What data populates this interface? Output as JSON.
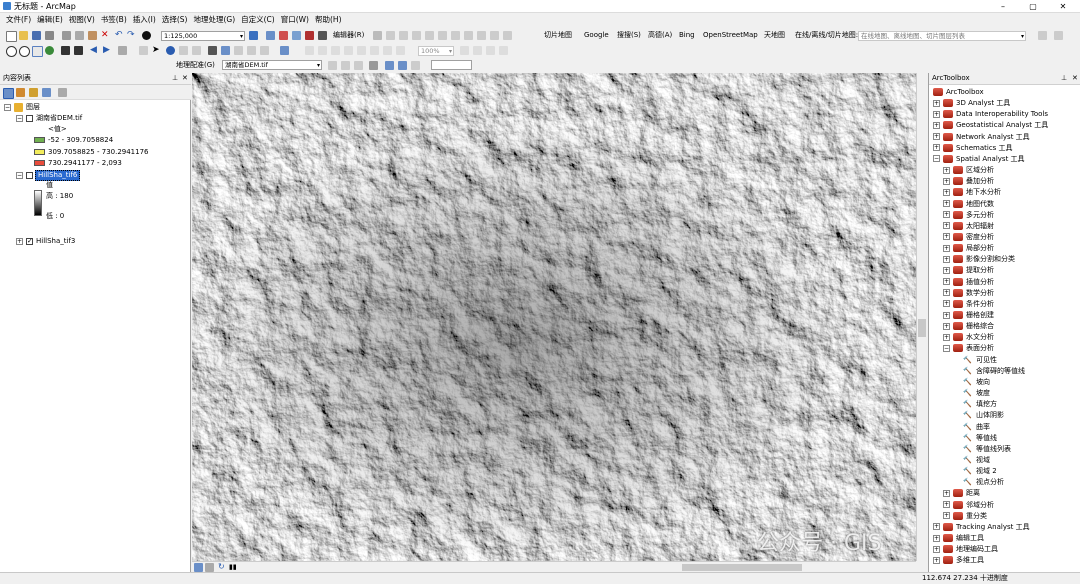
{
  "window": {
    "title": "无标题 - ArcMap"
  },
  "menu": [
    "文件(F)",
    "编辑(E)",
    "视图(V)",
    "书签(B)",
    "插入(I)",
    "选择(S)",
    "地理处理(G)",
    "自定义(C)",
    "窗口(W)",
    "帮助(H)"
  ],
  "toolbar": {
    "scale": "1:125,000",
    "editor": "编辑器(R)",
    "zoom_pct": "100%",
    "cut_map": "切片地图",
    "google": "Google",
    "baidu": "搜搜(S)",
    "gaode": "高德(A)",
    "bing": "Bing",
    "osm": "OpenStreetMap",
    "tianditu": "天地图",
    "online_label": "在线/离线/切片地图:",
    "online_placeholder": "在线地图、离线地图、切片图层列表",
    "georef": "地理配准(G)",
    "georef_layer": "湖南省DEM.tif"
  },
  "toc": {
    "title": "内容列表",
    "root": "图层",
    "layer1": {
      "name": "湖南省DEM.tif",
      "value_header": "<值>",
      "classes": [
        {
          "label": "-52 - 309.7058824",
          "color": "#70b050"
        },
        {
          "label": "309.7058825 - 730.2941176",
          "color": "#f2ec5c"
        },
        {
          "label": "730.2941177 - 2,093",
          "color": "#e84c3c"
        }
      ]
    },
    "layer2": {
      "name": "HillSha_tif6",
      "value_header": "值",
      "high": "高 : 180",
      "low": "低 : 0"
    },
    "layer3": {
      "name": "HillSha_tif3"
    }
  },
  "arctoolbox": {
    "title": "ArcToolbox",
    "root": "ArcToolbox",
    "toolboxes": [
      "3D Analyst 工具",
      "Data Interoperability Tools",
      "Geostatistical Analyst 工具",
      "Network Analyst 工具",
      "Schematics 工具",
      "Spatial Analyst 工具"
    ],
    "spatial_children": [
      "区域分析",
      "叠加分析",
      "地下水分析",
      "地图代数",
      "多元分析",
      "太阳辐射",
      "密度分析",
      "局部分析",
      "影像分割和分类",
      "提取分析",
      "插值分析",
      "数学分析",
      "条件分析",
      "栅格创建",
      "栅格综合",
      "水文分析",
      "表面分析"
    ],
    "surface_tools": [
      "可见性",
      "含障碍的等值线",
      "坡向",
      "坡度",
      "填挖方",
      "山体阴影",
      "曲率",
      "等值线",
      "等值线列表",
      "视域",
      "视域 2",
      "视点分析"
    ],
    "after_surface": [
      "距离",
      "邻域分析",
      "重分类"
    ],
    "bottom_toolboxes": [
      "Tracking Analyst 工具",
      "编辑工具",
      "地理编码工具",
      "多维工具"
    ]
  },
  "watermark": "公众号 · GIS",
  "status": {
    "coords": "112.674  27.234 十进制度"
  }
}
